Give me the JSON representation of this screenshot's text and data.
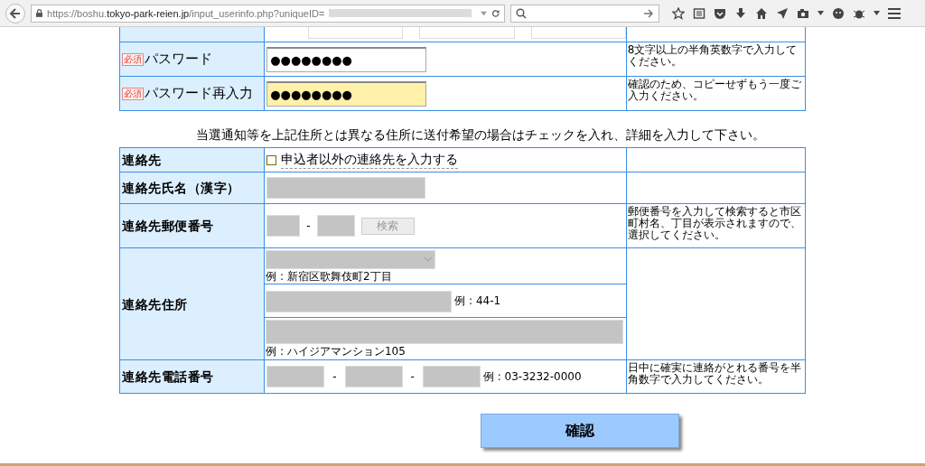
{
  "browser": {
    "url_host_prefix": "https://boshu.",
    "url_host": "tokyo-park-reien.jp",
    "url_path": "/input_userinfo.php?uniqueID="
  },
  "password_rows": [
    {
      "required": true,
      "required_badge": "必須",
      "label": "パスワード",
      "value": "●●●●●●●●",
      "highlighted": false,
      "hint": "8文字以上の半角英数字で入力してください。"
    },
    {
      "required": true,
      "required_badge": "必須",
      "label": "パスワード再入力",
      "value": "●●●●●●●●",
      "highlighted": true,
      "hint": "確認のため、コピーせずもう一度ご入力ください。"
    }
  ],
  "notice": "当選通知等を上記住所とは異なる住所に送付希望の場合はチェックを入れ、詳細を入力して下さい。",
  "contact_rows": [
    {
      "kind": "checkbox",
      "label": "連絡先",
      "checkbox": {
        "label": "申込者以外の連絡先を入力する",
        "checked": false
      }
    },
    {
      "kind": "name",
      "label": "連絡先氏名（漢字）",
      "disabled": true
    },
    {
      "kind": "postal",
      "label": "連絡先郵便番号",
      "disabled": true,
      "separator": "-",
      "search_button": "検索",
      "hint": "郵便番号を入力して検索すると市区町村名、丁目が表示されますので、選択してください。"
    },
    {
      "kind": "address",
      "label": "連絡先住所",
      "disabled": true,
      "lines": [
        {
          "kind": "select",
          "example": "例 : 新宿区歌舞伎町2丁目"
        },
        {
          "kind": "short",
          "example": "例 : 44-1"
        },
        {
          "kind": "long",
          "example": "例 : ハイジアマンション105"
        }
      ]
    },
    {
      "kind": "phone",
      "label": "連絡先電話番号",
      "disabled": true,
      "separators": [
        "-",
        "-"
      ],
      "example": "例 : 03-3232-0000",
      "hint": "日中に確実に連絡がとれる番号を半角数字で入力してください。"
    }
  ],
  "submit_button": "確認"
}
